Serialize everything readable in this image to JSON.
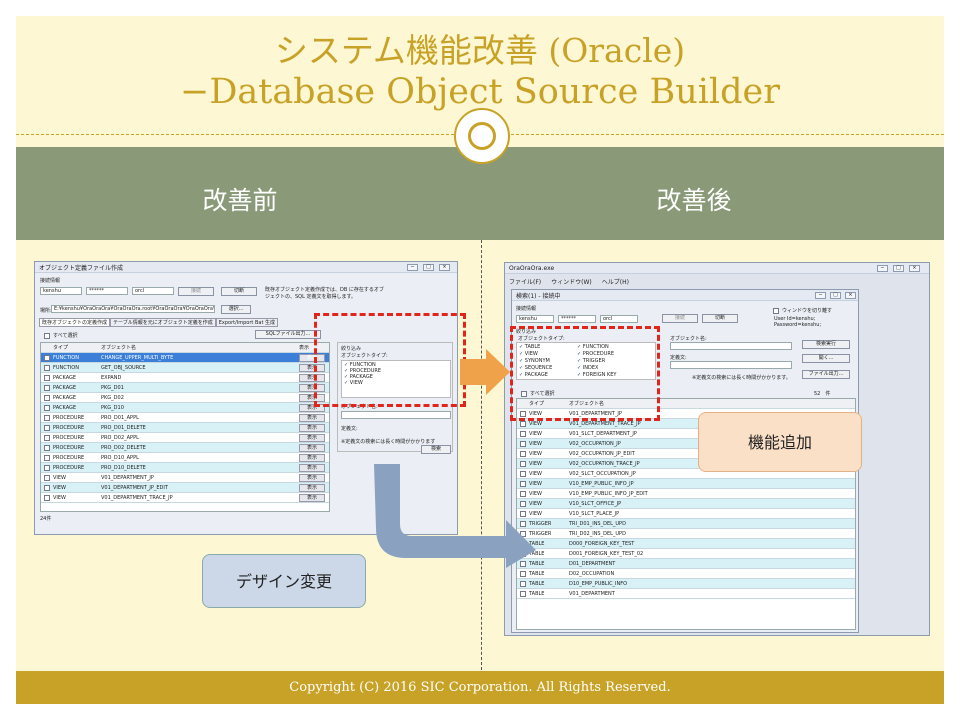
{
  "slide": {
    "title_line1": "システム機能改善 (Oracle)",
    "title_line2": "−Database Object Source Builder",
    "before_label": "改善前",
    "after_label": "改善後",
    "callout_design": "デザイン変更",
    "callout_feature": "機能追加",
    "footer": "Copyright (C) 2016 SIC Corporation. All Rights Reserved."
  },
  "before": {
    "title": "オブジェクト定義ファイル作成",
    "conn_label": "接続情報",
    "user": "kenshu",
    "password": "******",
    "db": "orcl",
    "btn_disconnect": "切断",
    "btn_connect": "接続",
    "info": "既存オブジェクト定義作成では、DB に存在するオブジェクトの、SQL 定義文を取得します。",
    "path_label": "場所:",
    "path": "E:¥kenshu¥OraOraOra¥OraOraOra.root¥OraOraOra¥OraOraOra¥bin",
    "btn_select": "選択...",
    "tabs": [
      "既存オブジェクトの定義作成",
      "テーブル情報を元にオブジェクト定義を作成",
      "Export/Import Bat 生成"
    ],
    "select_all": "すべて選択",
    "btn_sql": "SQLファイル出力...",
    "filter_label": "絞り込み",
    "type_label": "オブジェクトタイプ:",
    "types": [
      "FUNCTION",
      "PROCEDURE",
      "PACKAGE",
      "VIEW"
    ],
    "objname_label": "オブジェクト名:",
    "definition_label": "定義文:",
    "note": "※定義文の検索には長く時間がかかります",
    "btn_search": "検索",
    "col_type": "タイプ",
    "col_name": "オブジェクト名",
    "col_show": "表示",
    "show_btn": "表示",
    "count": "24件",
    "rows": [
      [
        "FUNCTION",
        "CHANGE_UPPER_MULTI_BYTE"
      ],
      [
        "FUNCTION",
        "GET_OBJ_SOURCE"
      ],
      [
        "PACKAGE",
        "EXPAND"
      ],
      [
        "PACKAGE",
        "PKG_D01"
      ],
      [
        "PACKAGE",
        "PKG_D02"
      ],
      [
        "PACKAGE",
        "PKG_D10"
      ],
      [
        "PROCEDURE",
        "PRO_D01_APPL"
      ],
      [
        "PROCEDURE",
        "PRO_D01_DELETE"
      ],
      [
        "PROCEDURE",
        "PRO_D02_APPL"
      ],
      [
        "PROCEDURE",
        "PRO_D02_DELETE"
      ],
      [
        "PROCEDURE",
        "PRO_D10_APPL"
      ],
      [
        "PROCEDURE",
        "PRO_D10_DELETE"
      ],
      [
        "VIEW",
        "V01_DEPARTMENT_JP"
      ],
      [
        "VIEW",
        "V01_DEPARTMENT_JP_EDIT"
      ],
      [
        "VIEW",
        "V01_DEPARTMENT_TRACE_JP"
      ]
    ]
  },
  "after": {
    "app_title": "OraOraOra.exe",
    "menus": [
      "ファイル(F)",
      "ウィンドウ(W)",
      "ヘルプ(H)"
    ],
    "child_title": "検索(1) - 接続中",
    "conn_label": "接続情報",
    "user": "kenshu",
    "password": "******",
    "db": "orcl",
    "btn_connect": "接続",
    "btn_disconnect": "切断",
    "window_opt": "ウィンドウを切り離す",
    "user_info": "User Id=kenshu; Password=kenshu;",
    "filter_label": "絞り込み",
    "type_label": "オブジェクトタイプ:",
    "types_left": [
      "TABLE",
      "VIEW",
      "SYNONYM",
      "SEQUENCE",
      "PACKAGE"
    ],
    "types_right": [
      "FUNCTION",
      "PROCEDURE",
      "TRIGGER",
      "INDEX",
      "FOREIGN KEY"
    ],
    "objname_label": "オブジェクト名:",
    "definition_label": "定義文:",
    "note": "※定義文の検索には長く時間がかかります。",
    "btn_search": "検索実行",
    "btn_open": "開く...",
    "btn_output": "ファイル出力...",
    "select_all": "すべて選択",
    "count": "52　件",
    "col_type": "タイプ",
    "col_name": "オブジェクト名",
    "rows": [
      [
        "VIEW",
        "V01_DEPARTMENT_JP"
      ],
      [
        "VIEW",
        "V01_DEPARTMENT_TRACE_JP"
      ],
      [
        "VIEW",
        "V01_SLCT_DEPARTMENT_JP"
      ],
      [
        "VIEW",
        "V02_OCCUPATION_JP"
      ],
      [
        "VIEW",
        "V02_OCCUPATION_JP_EDIT"
      ],
      [
        "VIEW",
        "V02_OCCUPATION_TRACE_JP"
      ],
      [
        "VIEW",
        "V02_SLCT_OCCUPATION_JP"
      ],
      [
        "VIEW",
        "V10_EMP_PUBLIC_INFO_JP"
      ],
      [
        "VIEW",
        "V10_EMP_PUBLIC_INFO_JP_EDIT"
      ],
      [
        "VIEW",
        "V10_SLCT_OFFICE_JP"
      ],
      [
        "VIEW",
        "V10_SLCT_PLACE_JP"
      ],
      [
        "TRIGGER",
        "TRI_D01_INS_DEL_UPD"
      ],
      [
        "TRIGGER",
        "TRI_D02_INS_DEL_UPD"
      ],
      [
        "TABLE",
        "D000_FOREIGN_KEY_TEST"
      ],
      [
        "TABLE",
        "D001_FOREIGN_KEY_TEST_02"
      ],
      [
        "TABLE",
        "D01_DEPARTMENT"
      ],
      [
        "TABLE",
        "D02_OCCUPATION"
      ],
      [
        "TABLE",
        "D10_EMP_PUBLIC_INFO"
      ],
      [
        "TABLE",
        "V01_DEPARTMENT"
      ]
    ]
  }
}
